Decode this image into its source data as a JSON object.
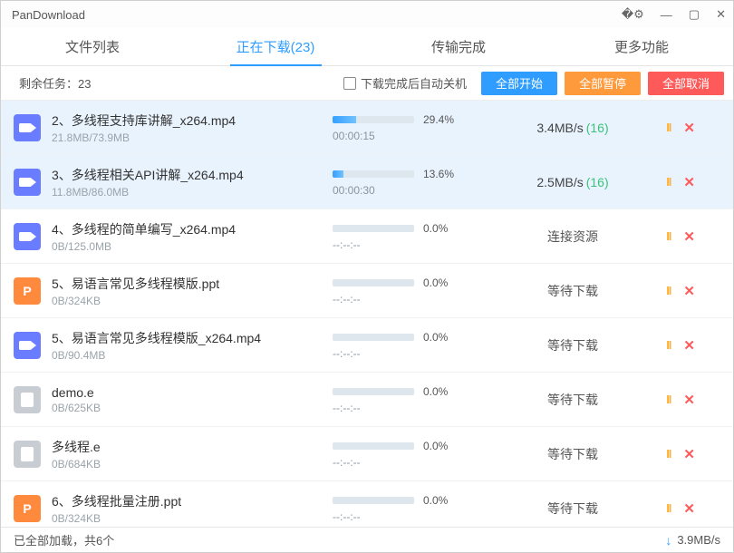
{
  "window": {
    "title": "PanDownload"
  },
  "tabs": [
    {
      "label": "文件列表"
    },
    {
      "label": "正在下载(23)",
      "active": true
    },
    {
      "label": "传输完成"
    },
    {
      "label": "更多功能"
    }
  ],
  "toolbar": {
    "remaining": "剩余任务：23",
    "shutdown_label": "下载完成后自动关机",
    "start_all": "全部开始",
    "pause_all": "全部暂停",
    "cancel_all": "全部取消"
  },
  "rows": [
    {
      "icon": "video",
      "name": "2、多线程支持库讲解_x264.mp4",
      "size": "21.8MB/73.9MB",
      "pct": "29.4%",
      "pctWidth": "29.4%",
      "time": "00:00:15",
      "speed": "3.4MB/s",
      "threads": "(16)"
    },
    {
      "icon": "video",
      "name": "3、多线程相关API讲解_x264.mp4",
      "size": "11.8MB/86.0MB",
      "pct": "13.6%",
      "pctWidth": "13.6%",
      "time": "00:00:30",
      "speed": "2.5MB/s",
      "threads": "(16)"
    },
    {
      "icon": "video",
      "name": "4、多线程的简单编写_x264.mp4",
      "size": "0B/125.0MB",
      "pct": "0.0%",
      "pctWidth": "0%",
      "time": "--:--:--",
      "status": "连接资源"
    },
    {
      "icon": "ppt",
      "iconText": "P",
      "name": "5、易语言常见多线程模版.ppt",
      "size": "0B/324KB",
      "pct": "0.0%",
      "pctWidth": "0%",
      "time": "--:--:--",
      "status": "等待下载"
    },
    {
      "icon": "video",
      "name": "5、易语言常见多线程模版_x264.mp4",
      "size": "0B/90.4MB",
      "pct": "0.0%",
      "pctWidth": "0%",
      "time": "--:--:--",
      "status": "等待下载"
    },
    {
      "icon": "file",
      "name": "demo.e",
      "size": "0B/625KB",
      "pct": "0.0%",
      "pctWidth": "0%",
      "time": "--:--:--",
      "status": "等待下载"
    },
    {
      "icon": "file",
      "name": "多线程.e",
      "size": "0B/684KB",
      "pct": "0.0%",
      "pctWidth": "0%",
      "time": "--:--:--",
      "status": "等待下载"
    },
    {
      "icon": "ppt",
      "iconText": "P",
      "name": "6、多线程批量注册.ppt",
      "size": "0B/324KB",
      "pct": "0.0%",
      "pctWidth": "0%",
      "time": "--:--:--",
      "status": "等待下载"
    }
  ],
  "statusbar": {
    "loaded": "已全部加载，共6个",
    "total_speed": "3.9MB/s"
  }
}
